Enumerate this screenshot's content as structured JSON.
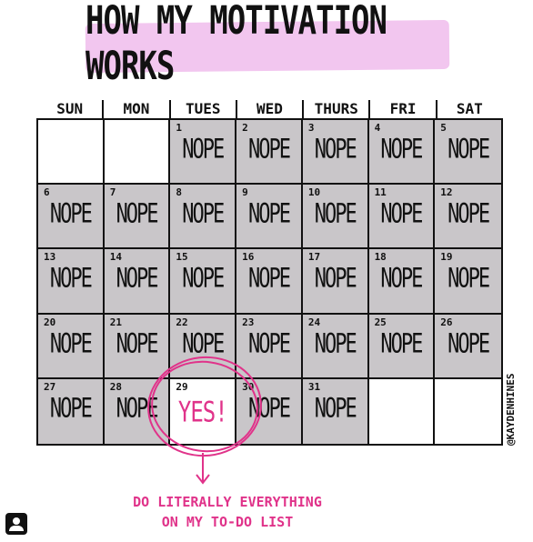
{
  "title": "HOW MY MOTIVATION WORKS",
  "days": [
    "SUN",
    "MON",
    "TUES",
    "WED",
    "THURS",
    "FRI",
    "SAT"
  ],
  "cells": [
    {
      "num": "",
      "text": ""
    },
    {
      "num": "",
      "text": ""
    },
    {
      "num": "1",
      "text": "NOPE"
    },
    {
      "num": "2",
      "text": "NOPE"
    },
    {
      "num": "3",
      "text": "NOPE"
    },
    {
      "num": "4",
      "text": "NOPE"
    },
    {
      "num": "5",
      "text": "NOPE"
    },
    {
      "num": "6",
      "text": "NOPE"
    },
    {
      "num": "7",
      "text": "NOPE"
    },
    {
      "num": "8",
      "text": "NOPE"
    },
    {
      "num": "9",
      "text": "NOPE"
    },
    {
      "num": "10",
      "text": "NOPE"
    },
    {
      "num": "11",
      "text": "NOPE"
    },
    {
      "num": "12",
      "text": "NOPE"
    },
    {
      "num": "13",
      "text": "NOPE"
    },
    {
      "num": "14",
      "text": "NOPE"
    },
    {
      "num": "15",
      "text": "NOPE"
    },
    {
      "num": "16",
      "text": "NOPE"
    },
    {
      "num": "17",
      "text": "NOPE"
    },
    {
      "num": "18",
      "text": "NOPE"
    },
    {
      "num": "19",
      "text": "NOPE"
    },
    {
      "num": "20",
      "text": "NOPE"
    },
    {
      "num": "21",
      "text": "NOPE"
    },
    {
      "num": "22",
      "text": "NOPE"
    },
    {
      "num": "23",
      "text": "NOPE"
    },
    {
      "num": "24",
      "text": "NOPE"
    },
    {
      "num": "25",
      "text": "NOPE"
    },
    {
      "num": "26",
      "text": "NOPE"
    },
    {
      "num": "27",
      "text": "NOPE"
    },
    {
      "num": "28",
      "text": "NOPE"
    },
    {
      "num": "29",
      "text": "YES!",
      "highlight": true
    },
    {
      "num": "30",
      "text": "NOPE"
    },
    {
      "num": "31",
      "text": "NOPE"
    },
    {
      "num": "",
      "text": ""
    },
    {
      "num": "",
      "text": ""
    }
  ],
  "caption_line1": "DO LITERALLY EVERYTHING",
  "caption_line2": "ON MY TO-DO LIST",
  "credit": "@KAYDENHINES",
  "colors": {
    "accent": "#e0338a",
    "highlight_bg": "#f2c6ef",
    "cell_fill": "#c9c6c9"
  },
  "icons": {
    "corner": "instagram-user-icon"
  }
}
